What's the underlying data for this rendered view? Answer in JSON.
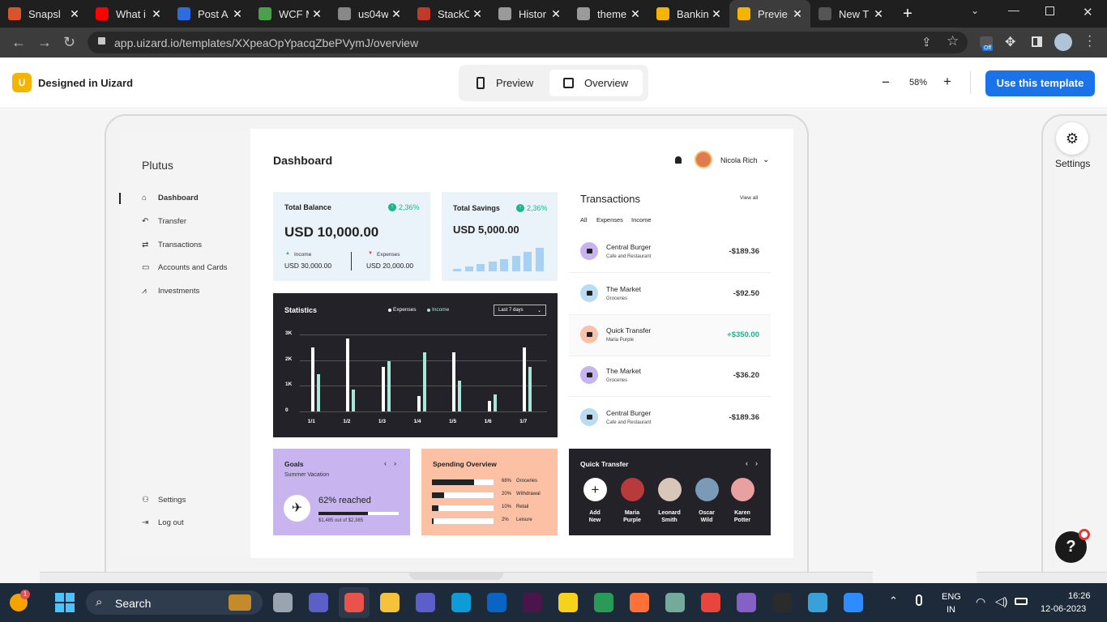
{
  "browser": {
    "tabs": [
      {
        "title": "Snapsl",
        "fav": "#d9542b",
        "x": 0,
        "w": 108
      },
      {
        "title": "What i",
        "fav": "#ff0000",
        "x": 108,
        "w": 101
      },
      {
        "title": "Post A",
        "fav": "#2d6cdf",
        "x": 209,
        "w": 100
      },
      {
        "title": "WCF M",
        "fav": "#4aa14a",
        "x": 309,
        "w": 98
      },
      {
        "title": "us04w",
        "fav": "#888888",
        "x": 407,
        "w": 98
      },
      {
        "title": "StackC",
        "fav": "#c0392b",
        "x": 505,
        "w": 100
      },
      {
        "title": "Histor",
        "fav": "#9a9a9a",
        "x": 605,
        "w": 97
      },
      {
        "title": "theme",
        "fav": "#9a9a9a",
        "x": 702,
        "w": 98
      },
      {
        "title": "Bankin",
        "fav": "#f5b400",
        "x": 800,
        "w": 100
      },
      {
        "title": "Previe",
        "fav": "#f5b400",
        "x": 900,
        "w": 100,
        "active": true
      },
      {
        "title": "New T",
        "fav": "#555555",
        "x": 1000,
        "w": 100
      }
    ],
    "close_glyph": "✕",
    "new_tab": "+",
    "url": "app.uizard.io/templates/XXpeaOpYpacqZbePVymJ/overview",
    "ext_badge": "Off"
  },
  "uizard": {
    "brand": "Designed in Uizard",
    "preview_label": "Preview",
    "overview_label": "Overview",
    "zoom": "58%",
    "zoom_minus": "−",
    "zoom_plus": "+",
    "cta": "Use this template",
    "settings_label": "Settings"
  },
  "dash": {
    "logo": "Plutus",
    "menu": [
      {
        "label": "Dashboard",
        "icon": "home-icon",
        "glyph": "⌂"
      },
      {
        "label": "Transfer",
        "icon": "reply-icon",
        "glyph": "↶"
      },
      {
        "label": "Transactions",
        "icon": "exchange-icon",
        "glyph": "⇄"
      },
      {
        "label": "Accounts and Cards",
        "icon": "card-icon",
        "glyph": "▭"
      },
      {
        "label": "Investments",
        "icon": "chart-icon",
        "glyph": "⩘"
      }
    ],
    "settings": "Settings",
    "logout": "Log out",
    "page_title": "Dashboard",
    "user_name": "Nicola Rich",
    "balance": {
      "title": "Total Balance",
      "change": "2,36%",
      "amount": "USD 10,000.00",
      "income_label": "Income",
      "income": "USD 30,000.00",
      "expenses_label": "Expenses",
      "expenses": "USD 20,000.00"
    },
    "savings": {
      "title": "Total Savings",
      "change": "2,36%",
      "amount": "USD 5,000.00",
      "bars": [
        0.1,
        0.18,
        0.28,
        0.38,
        0.5,
        0.62,
        0.78,
        0.92
      ]
    },
    "statistics": {
      "title": "Statistics",
      "legend_expenses": "Expenses",
      "legend_income": "Income",
      "range": "Last 7 days"
    },
    "transactions": {
      "title": "Transactions",
      "view_all": "View all",
      "filters": [
        "All",
        "Expenses",
        "Income"
      ],
      "items": [
        {
          "name": "Central Burger",
          "sub": "Cafe and Restaurant",
          "amount": "-$189.36",
          "color": "#c7b3ef",
          "positive": false
        },
        {
          "name": "The Market",
          "sub": "Groceries",
          "amount": "-$92.50",
          "color": "#b9dcf2",
          "positive": false
        },
        {
          "name": "Quick Transfer",
          "sub": "Maria Purple",
          "amount": "+$350.00",
          "color": "#f8c1a8",
          "positive": true
        },
        {
          "name": "The Market",
          "sub": "Groceries",
          "amount": "-$36.20",
          "color": "#c7b3ef",
          "positive": false
        },
        {
          "name": "Central Burger",
          "sub": "Cafe and Restaurant",
          "amount": "-$189.36",
          "color": "#b9dcf2",
          "positive": false
        }
      ]
    },
    "goals": {
      "title": "Goals",
      "sub": "Summer Vacation",
      "reached": "62% reached",
      "progress": 0.62,
      "detail": "$1,485 out of $2,385"
    },
    "spending": {
      "title": "Spending Overview",
      "items": [
        {
          "pct": "68%",
          "label": "Groceries",
          "value": 0.68
        },
        {
          "pct": "20%",
          "label": "Withdrawal",
          "value": 0.2
        },
        {
          "pct": "10%",
          "label": "Retail",
          "value": 0.1
        },
        {
          "pct": "2%",
          "label": "Leisure",
          "value": 0.02
        }
      ]
    },
    "quick": {
      "title": "Quick Transfer",
      "people": [
        {
          "line1": "Add",
          "line2": "New",
          "color": "#ffffff"
        },
        {
          "line1": "Maria",
          "line2": "Purple",
          "color": "#b83a3a"
        },
        {
          "line1": "Leonard",
          "line2": "Smith",
          "color": "#d8c7b8"
        },
        {
          "line1": "Oscar",
          "line2": "Wild",
          "color": "#7a9ab8"
        },
        {
          "line1": "Karen",
          "line2": "Potter",
          "color": "#e8a0a0"
        }
      ]
    }
  },
  "chart_data": {
    "type": "bar",
    "categories": [
      "1/1",
      "1/2",
      "1/3",
      "1/4",
      "1/5",
      "1/6",
      "1/7"
    ],
    "series": [
      {
        "name": "Expenses",
        "values": [
          2500,
          2850,
          1750,
          600,
          2300,
          400,
          2500
        ]
      },
      {
        "name": "Income",
        "values": [
          1450,
          850,
          1950,
          2300,
          1200,
          650,
          1750
        ]
      }
    ],
    "y_ticks": [
      "3K",
      "2K",
      "1K",
      "0"
    ],
    "ylim": [
      0,
      3000
    ],
    "colors": {
      "Expenses": "#ffffff",
      "Income": "#a8e6d8"
    }
  },
  "taskbar": {
    "search": "Search",
    "lang1": "ENG",
    "lang2": "IN",
    "time": "16:26",
    "date": "12-06-2023",
    "notif": "1"
  }
}
